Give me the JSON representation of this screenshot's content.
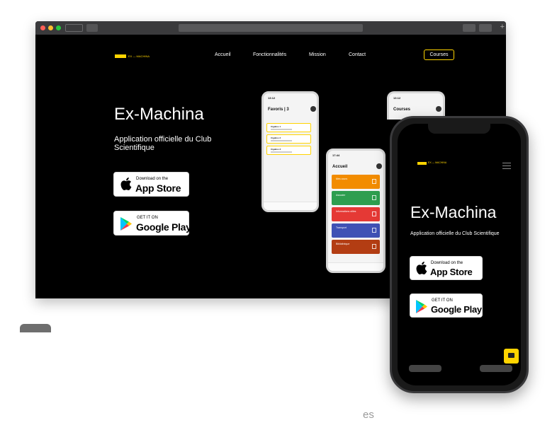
{
  "window": {
    "title": "",
    "address": ""
  },
  "site": {
    "logo_text": "EX — MACHINA",
    "nav": [
      {
        "label": "Accueil"
      },
      {
        "label": "Fonctionnalités"
      },
      {
        "label": "Mission"
      },
      {
        "label": "Contact"
      }
    ],
    "cta": "Courses",
    "hero_title": "Ex-Machina",
    "hero_subtitle": "Application officielle du Club Scientifique",
    "app_store": {
      "small": "Download on the",
      "large": "App Store"
    },
    "google_play": {
      "small": "GET IT ON",
      "large": "Google Play"
    }
  },
  "mini_phones": {
    "favoris": {
      "time": "13:12",
      "title": "Favoris | 3",
      "items": [
        "Cigalios 1",
        "Cigalios 2",
        "Cigalios 3"
      ]
    },
    "accueil": {
      "time": "17:44",
      "title": "Accueil",
      "tiles": [
        {
          "label": "Mes cours",
          "color": "#f28c00"
        },
        {
          "label": "Associer",
          "color": "#2e9e4f"
        },
        {
          "label": "Informations utiles",
          "color": "#e53935"
        },
        {
          "label": "Transport",
          "color": "#3f51b5"
        },
        {
          "label": "Bibliothèque",
          "color": "#b33d13"
        }
      ]
    },
    "courses": {
      "time": "13:12",
      "title": "Courses"
    }
  },
  "phone": {
    "logo_text": "EX — MACHINA",
    "title": "Ex-Machina",
    "subtitle": "Application officielle du Club Scientifique",
    "app_store": {
      "small": "Download on the",
      "large": "App Store"
    },
    "google_play": {
      "small": "GET IT ON",
      "large": "Google Play"
    }
  },
  "page_footer_text": "es",
  "colors": {
    "accent": "#ffd400",
    "background": "#000000"
  }
}
